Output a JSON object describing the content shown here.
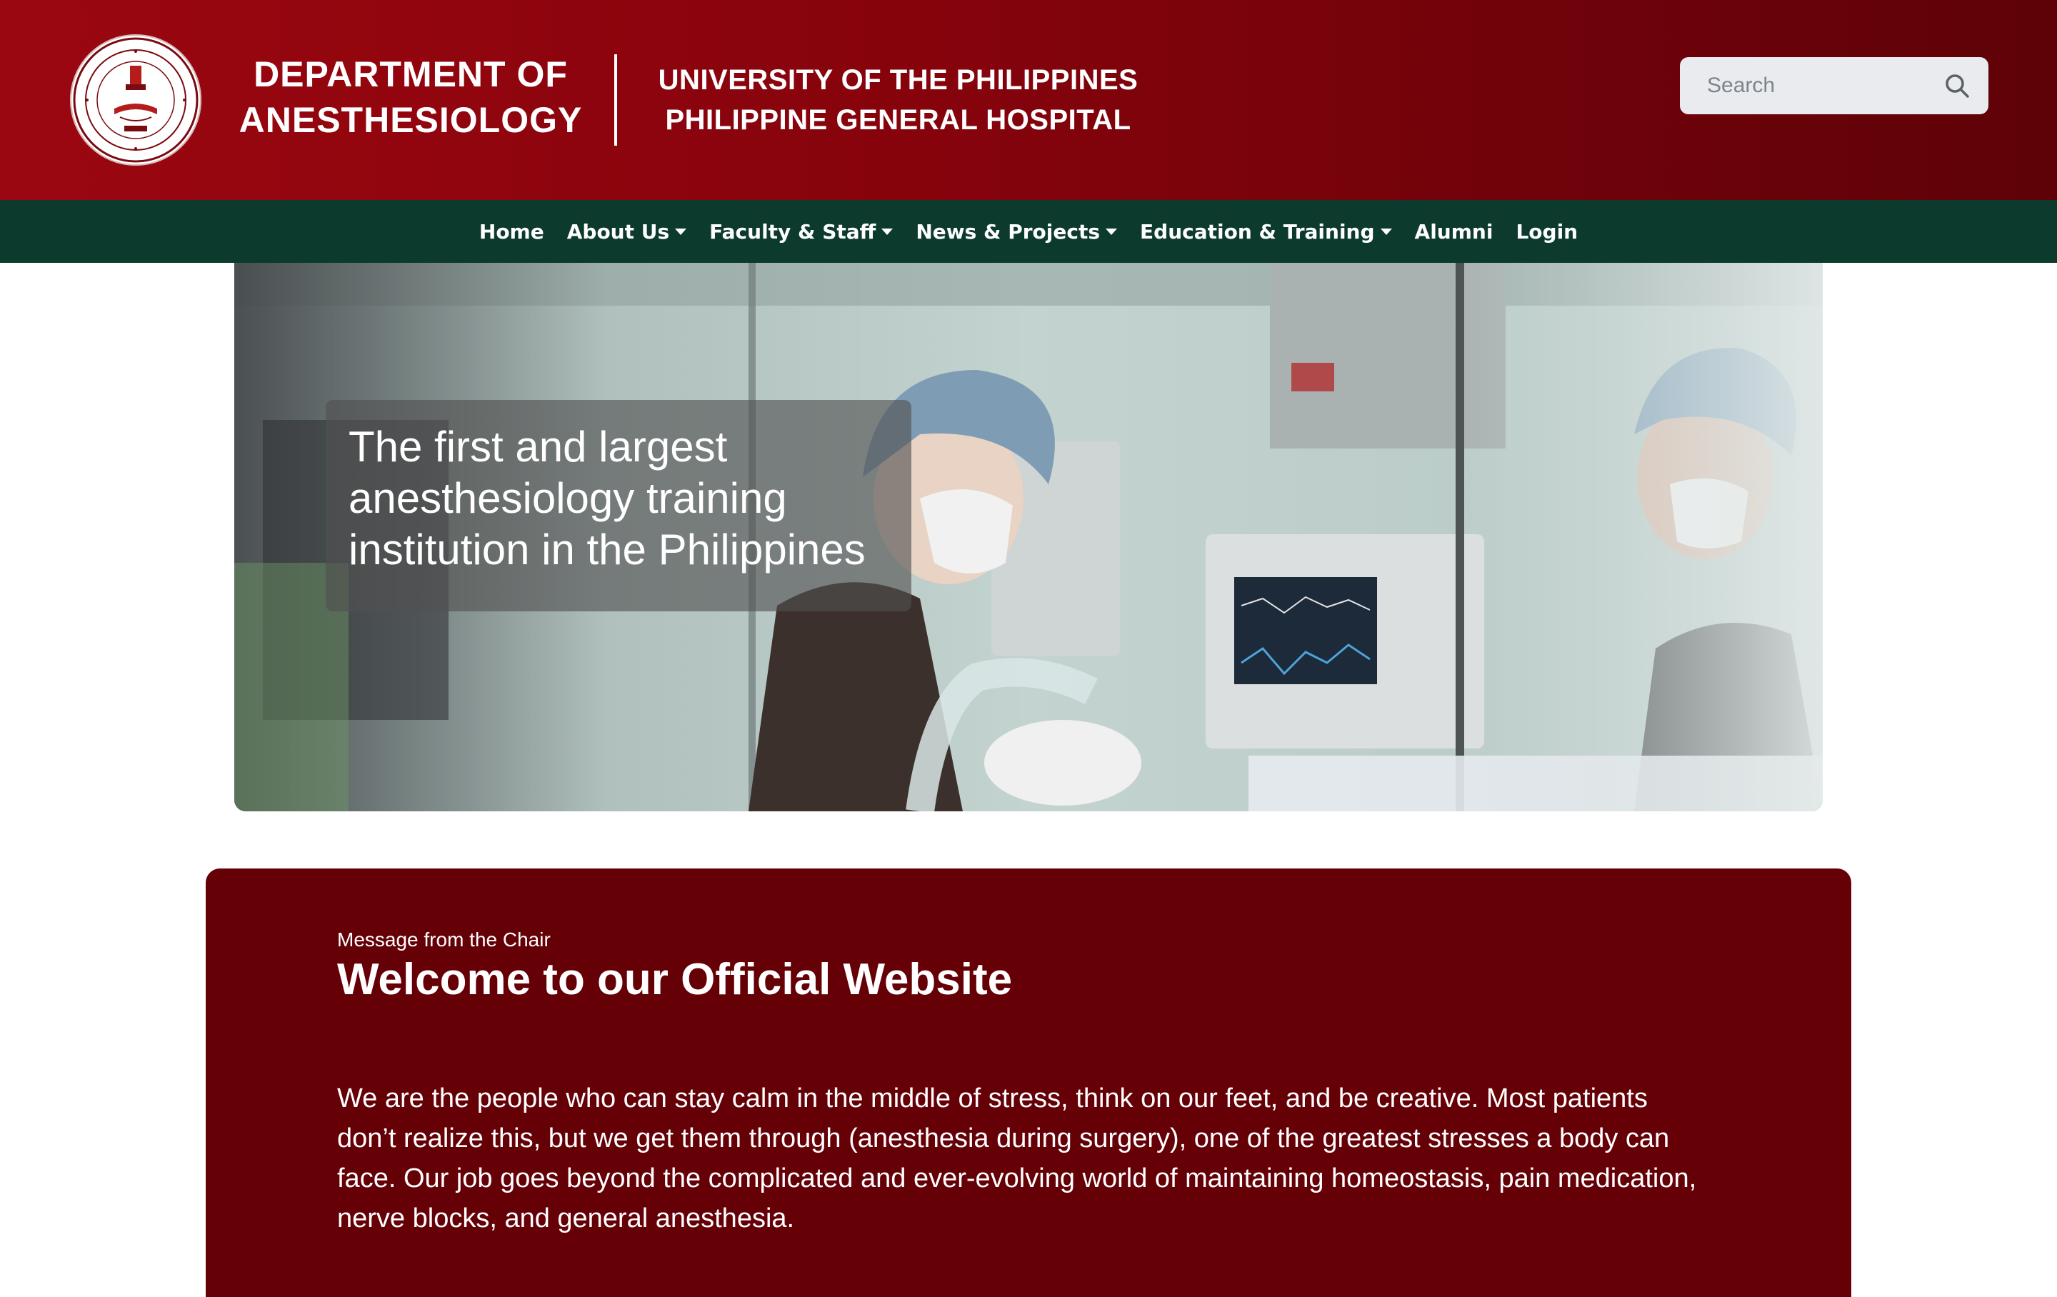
{
  "header": {
    "dept_line1": "DEPARTMENT OF",
    "dept_line2": "ANESTHESIOLOGY",
    "uni_line1": "UNIVERSITY OF THE PHILIPPINES",
    "uni_line2": "PHILIPPINE GENERAL HOSPITAL",
    "logo": {
      "outer_text": "UNIVERSITY OF THE PHILIPPINES · PHILIPPINE GENERAL HOSPITAL",
      "inner_text": "DEPARTMENT OF ANESTHESIOLOGY",
      "motto": "VIGILANCE",
      "year": "1962"
    },
    "search": {
      "placeholder": "Search",
      "icon": "search-icon"
    }
  },
  "nav": {
    "items": [
      {
        "label": "Home",
        "dropdown": false
      },
      {
        "label": "About Us",
        "dropdown": true
      },
      {
        "label": "Faculty & Staff",
        "dropdown": true
      },
      {
        "label": "News & Projects",
        "dropdown": true
      },
      {
        "label": "Education & Training",
        "dropdown": true
      },
      {
        "label": "Alumni",
        "dropdown": false
      },
      {
        "label": "Login",
        "dropdown": false
      }
    ]
  },
  "hero": {
    "caption": "The first and largest anesthesiology training institution in the Philippines"
  },
  "welcome": {
    "kicker": "Message from the Chair",
    "title": "Welcome to our Official Website",
    "body": "We are the people who can stay calm in the middle of stress, think on our feet, and be creative. Most patients don’t realize this, but we get them through (anesthesia during surgery), one of the greatest stresses a body can face. Our job goes beyond the complicated and ever-evolving world of maintaining homeostasis, pain medication, nerve blocks, and general anesthesia."
  },
  "colors": {
    "header_red": "#9b0710",
    "nav_green": "#0c3b2e",
    "welcome_maroon": "#650007"
  }
}
